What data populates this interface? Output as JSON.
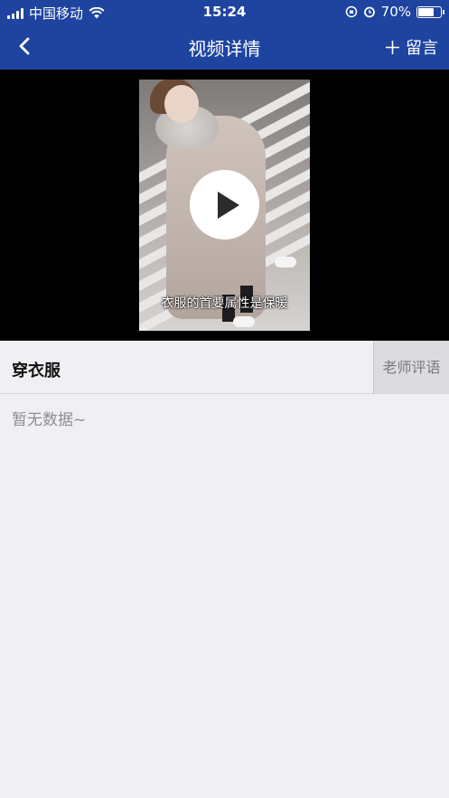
{
  "status_bar": {
    "carrier": "中国移动",
    "time": "15:24",
    "battery_percent": "70%",
    "battery_level": 0.7
  },
  "nav": {
    "title": "视频详情",
    "action_label": "留言",
    "icons": {
      "back": "chevron-left-icon",
      "add": "plus-icon"
    }
  },
  "video": {
    "caption": "衣服的首要属性是保暖",
    "play_icon": "play-icon"
  },
  "detail": {
    "title": "穿衣服",
    "teacher_comment_button": "老师评语",
    "empty_text": "暂无数据~"
  },
  "colors": {
    "brand": "#1e44a0",
    "background": "#efeff4"
  }
}
